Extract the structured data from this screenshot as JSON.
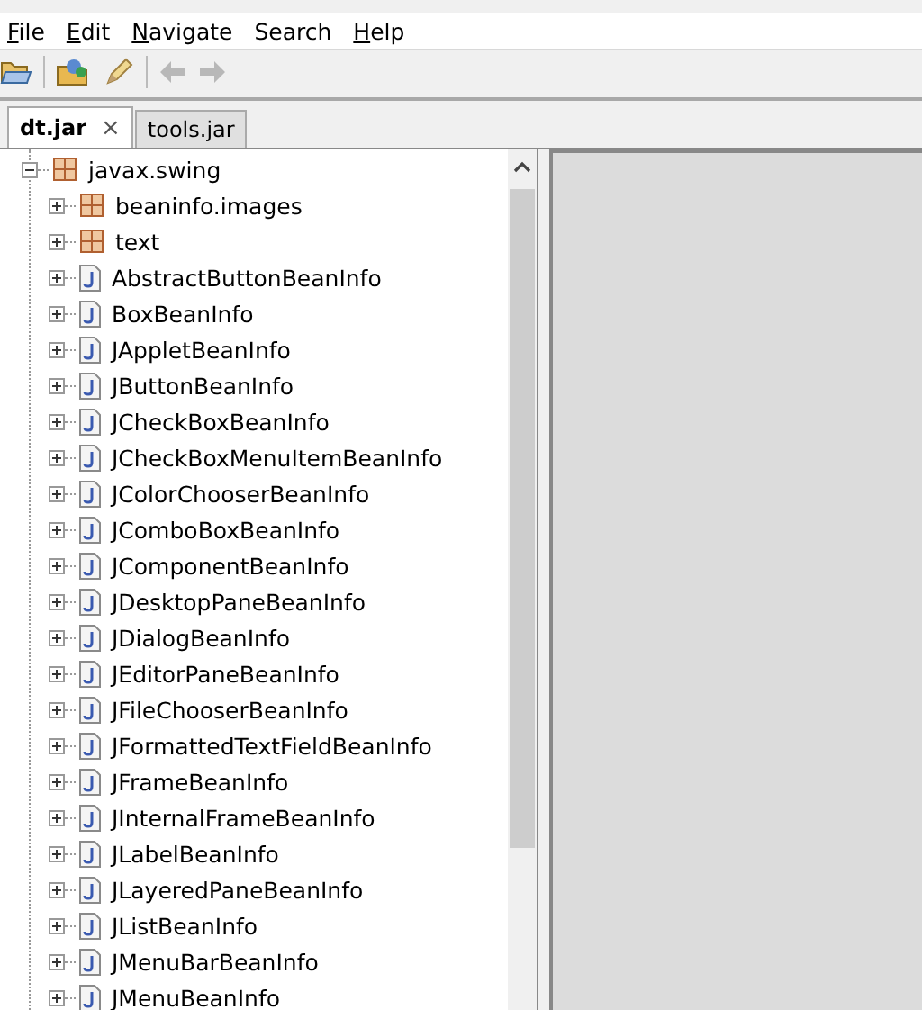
{
  "menu": [
    {
      "label": "File",
      "mnemonic_underlined": true
    },
    {
      "label": "Edit",
      "mnemonic_underlined": true
    },
    {
      "label": "Navigate",
      "mnemonic_underlined": true
    },
    {
      "label": "Search",
      "mnemonic_underlined": false
    },
    {
      "label": "Help",
      "mnemonic_underlined": true
    }
  ],
  "tabs": [
    {
      "label": "dt.jar",
      "selected": true,
      "close": "×"
    },
    {
      "label": "tools.jar",
      "selected": false
    }
  ],
  "tree": [
    {
      "label": "javax.swing",
      "kind": "package",
      "expanded": true,
      "children": [
        {
          "label": "beaninfo.images",
          "kind": "package",
          "expanded": false
        },
        {
          "label": "text",
          "kind": "package",
          "expanded": false
        },
        {
          "label": "AbstractButtonBeanInfo",
          "kind": "class",
          "expanded": false
        },
        {
          "label": "BoxBeanInfo",
          "kind": "class",
          "expanded": false
        },
        {
          "label": "JAppletBeanInfo",
          "kind": "class",
          "expanded": false
        },
        {
          "label": "JButtonBeanInfo",
          "kind": "class",
          "expanded": false
        },
        {
          "label": "JCheckBoxBeanInfo",
          "kind": "class",
          "expanded": false
        },
        {
          "label": "JCheckBoxMenuItemBeanInfo",
          "kind": "class",
          "expanded": false
        },
        {
          "label": "JColorChooserBeanInfo",
          "kind": "class",
          "expanded": false
        },
        {
          "label": "JComboBoxBeanInfo",
          "kind": "class",
          "expanded": false
        },
        {
          "label": "JComponentBeanInfo",
          "kind": "class",
          "expanded": false
        },
        {
          "label": "JDesktopPaneBeanInfo",
          "kind": "class",
          "expanded": false
        },
        {
          "label": "JDialogBeanInfo",
          "kind": "class",
          "expanded": false
        },
        {
          "label": "JEditorPaneBeanInfo",
          "kind": "class",
          "expanded": false
        },
        {
          "label": "JFileChooserBeanInfo",
          "kind": "class",
          "expanded": false
        },
        {
          "label": "JFormattedTextFieldBeanInfo",
          "kind": "class",
          "expanded": false
        },
        {
          "label": "JFrameBeanInfo",
          "kind": "class",
          "expanded": false
        },
        {
          "label": "JInternalFrameBeanInfo",
          "kind": "class",
          "expanded": false
        },
        {
          "label": "JLabelBeanInfo",
          "kind": "class",
          "expanded": false
        },
        {
          "label": "JLayeredPaneBeanInfo",
          "kind": "class",
          "expanded": false
        },
        {
          "label": "JListBeanInfo",
          "kind": "class",
          "expanded": false
        },
        {
          "label": "JMenuBarBeanInfo",
          "kind": "class",
          "expanded": false
        },
        {
          "label": "JMenuBeanInfo",
          "kind": "class",
          "expanded": false
        }
      ]
    }
  ]
}
